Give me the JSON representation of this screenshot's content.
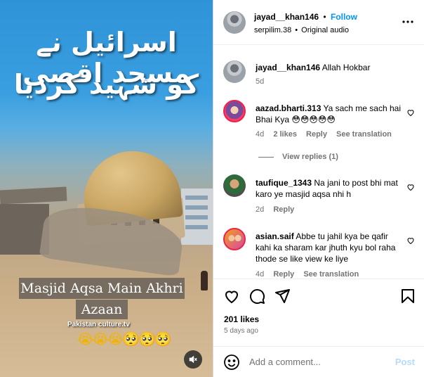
{
  "media": {
    "urdu_line1": "اسرائیل نے مسجد اقصی",
    "urdu_line2": "کو شہید کردیا",
    "caption_line1": "Masjid Aqsa Main Akhri",
    "caption_line2": "Azaan",
    "watermark": "Pakistan culture.tv",
    "emojis": "😭😭😭🥺🥺🥺",
    "mute_icon": "speaker-muted-icon"
  },
  "header": {
    "username": "jayad__khan146",
    "separator": "•",
    "follow_label": "Follow",
    "audio_user": "serpilim.38",
    "audio_sep": "•",
    "audio_label": "Original audio",
    "more_icon": "more-options-icon"
  },
  "caption_comment": {
    "username": "jayad__khan146",
    "text": "Allah Hokbar",
    "time": "5d"
  },
  "comments": [
    {
      "username": "aazad.bharti.313",
      "text": "Ya sach me sach hai Bhai Kya 😳😳😳😳😳",
      "time": "4d",
      "likes": "2 likes",
      "reply": "Reply",
      "translate": "See translation"
    },
    {
      "username": "taufique_1343",
      "text": "Na jani to post bhi mat karo ye masjid aqsa nhi h",
      "time": "2d",
      "reply": "Reply"
    },
    {
      "username": "asian.saif",
      "text": "Abbe tu jahil kya be qafir kahi ka sharam kar jhuth kyu bol raha thode se like view ke liye",
      "time": "4d",
      "reply": "Reply",
      "translate": "See translation"
    }
  ],
  "view_replies": "View replies (1)",
  "actions": {
    "likes": "201 likes",
    "ago": "5 days ago"
  },
  "add_comment": {
    "placeholder": "Add a comment...",
    "post_label": "Post"
  },
  "colors": {
    "accent": "#0095f6",
    "muted": "#737373",
    "post_disabled": "#b3dbff"
  }
}
